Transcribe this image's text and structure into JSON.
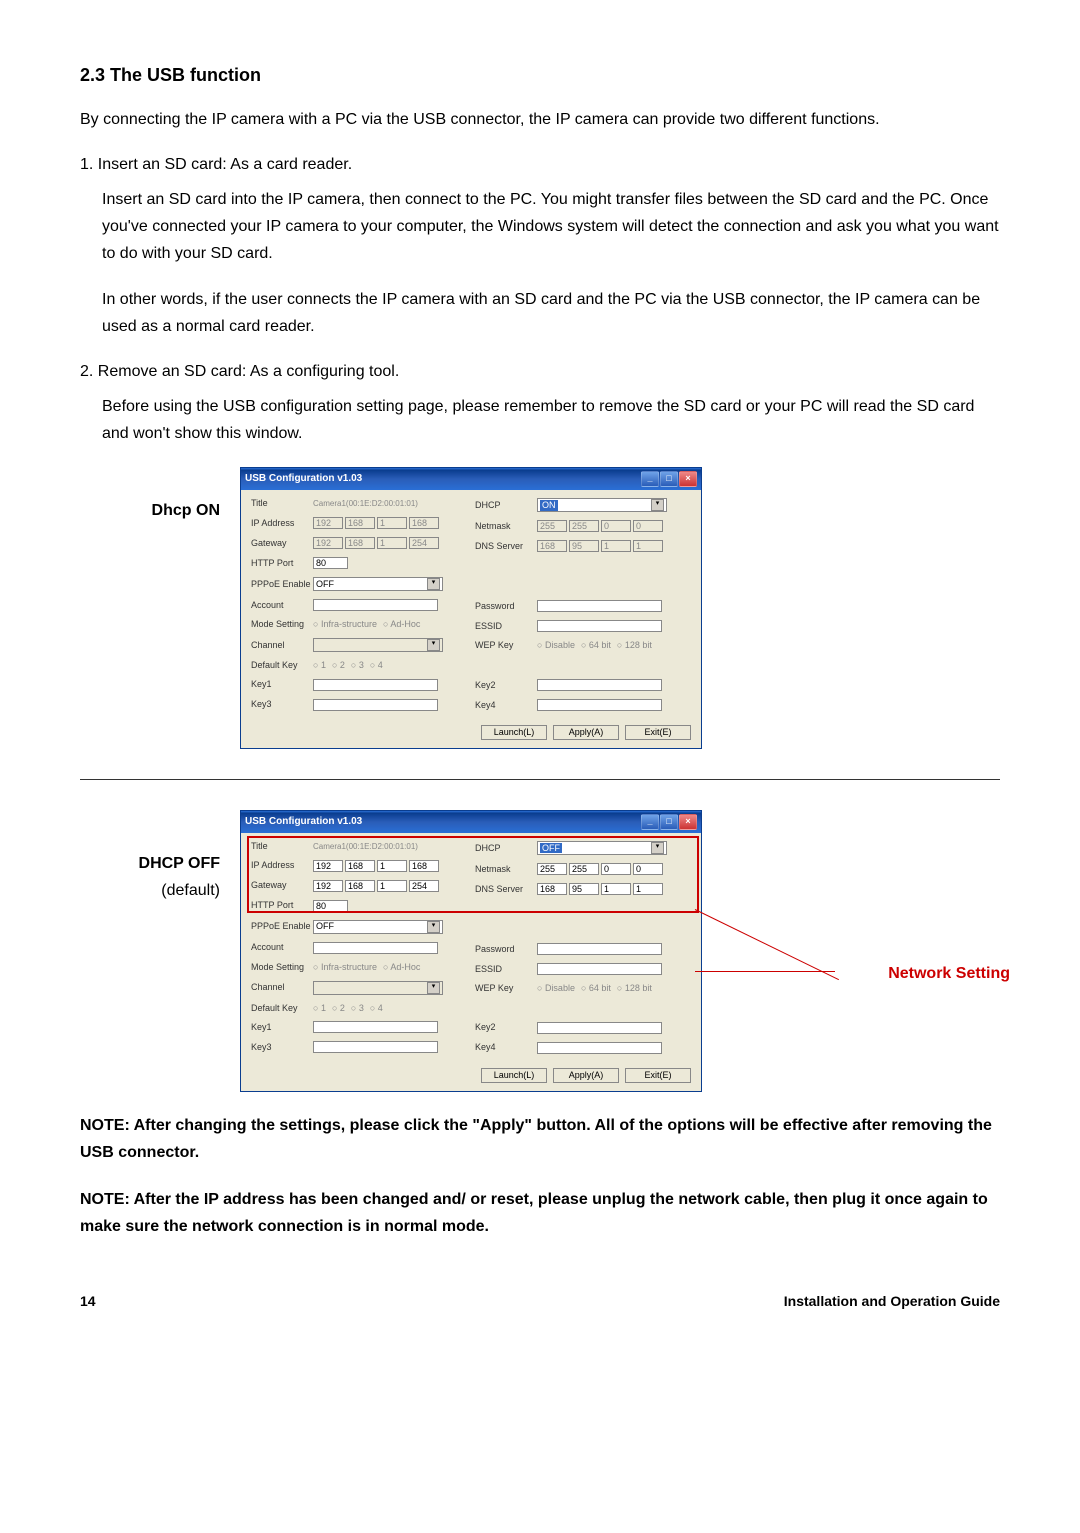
{
  "doc": {
    "heading": "2.3 The USB function",
    "intro": "By connecting the IP camera with a PC via the USB connector, the IP camera can provide two different functions.",
    "item1_title": "1. Insert an SD card: As a card reader.",
    "item1_body1": "Insert an SD card into the IP camera, then connect to the PC. You might transfer files between the SD card and the PC. Once you've connected your IP camera to your computer, the Windows system will detect the connection and ask you what you want to do with your SD card.",
    "item1_body2": "In other words, if the user connects the IP camera with an SD card and the PC via the USB connector, the IP camera can be used as a normal card reader.",
    "item2_title": "2. Remove an SD card: As a configuring tool.",
    "item2_body": "Before using the USB configuration setting page, please remember to remove the SD card or your PC will read the SD card and won't show this window.",
    "label_on": "Dhcp ON",
    "label_off": "DHCP OFF",
    "label_default": "(default)",
    "callout": "Network Setting",
    "note1": "NOTE: After changing the settings, please click the \"Apply\" button. All of the options will be effective after removing the USB connector.",
    "note2": "NOTE: After the IP address has been changed and/ or reset, please unplug the network cable, then plug it once again to make sure the network connection is in normal mode.",
    "page": "14",
    "guide": "Installation and Operation Guide"
  },
  "win": {
    "title": "USB Configuration v1.03",
    "labels": {
      "title_field": "Title",
      "ip": "IP Address",
      "gw": "Gateway",
      "http": "HTTP Port",
      "pppoe": "PPPoE Enable",
      "account": "Account",
      "mode": "Mode Setting",
      "channel": "Channel",
      "defkey": "Default Key",
      "key1": "Key1",
      "key3": "Key3",
      "dhcp": "DHCP",
      "netmask": "Netmask",
      "dns": "DNS Server",
      "password": "Password",
      "essid": "ESSID",
      "wepkey": "WEP Key",
      "key2": "Key2",
      "key4": "Key4"
    },
    "values": {
      "title_text": "Camera1(00:1E:D2:00:01:01)",
      "ip": [
        "192",
        "168",
        "1",
        "168"
      ],
      "gw": [
        "192",
        "168",
        "1",
        "254"
      ],
      "http": "80",
      "pppoe": "OFF",
      "mode_infra": "Infra-structure",
      "mode_adhoc": "Ad-Hoc",
      "defkeys": [
        "1",
        "2",
        "3",
        "4"
      ],
      "dhcp_on": "ON",
      "dhcp_off": "OFF",
      "netmask": [
        "255",
        "255",
        "0",
        "0"
      ],
      "dns": [
        "168",
        "95",
        "1",
        "1"
      ],
      "wep": [
        "Disable",
        "64 bit",
        "128 bit"
      ]
    },
    "buttons": {
      "launch": "Launch(L)",
      "apply": "Apply(A)",
      "exit": "Exit(E)"
    }
  }
}
